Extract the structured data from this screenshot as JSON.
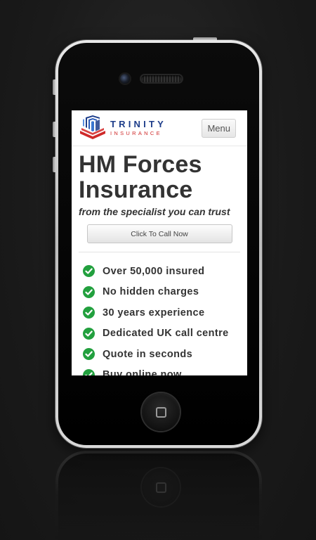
{
  "brand": {
    "name": "TRINITY",
    "tagline": "INSURANCE",
    "primary_color": "#1d3d8a",
    "accent_color": "#cf2a2a"
  },
  "header": {
    "menu_label": "Menu"
  },
  "hero": {
    "title_line1": "HM Forces",
    "title_line2": "Insurance",
    "subtitle": "from the specialist you can trust",
    "call_button_label": "Click To Call Now"
  },
  "features": [
    {
      "text": "Over 50,000 insured",
      "icon": "check-circle-icon"
    },
    {
      "text": "No hidden charges",
      "icon": "check-circle-icon"
    },
    {
      "text": "30 years experience",
      "icon": "check-circle-icon"
    },
    {
      "text": "Dedicated UK call centre",
      "icon": "check-circle-icon"
    },
    {
      "text": "Quote in seconds",
      "icon": "check-circle-icon"
    },
    {
      "text": "Buy online now",
      "icon": "check-circle-icon"
    }
  ],
  "colors": {
    "check": "#22a03e"
  }
}
